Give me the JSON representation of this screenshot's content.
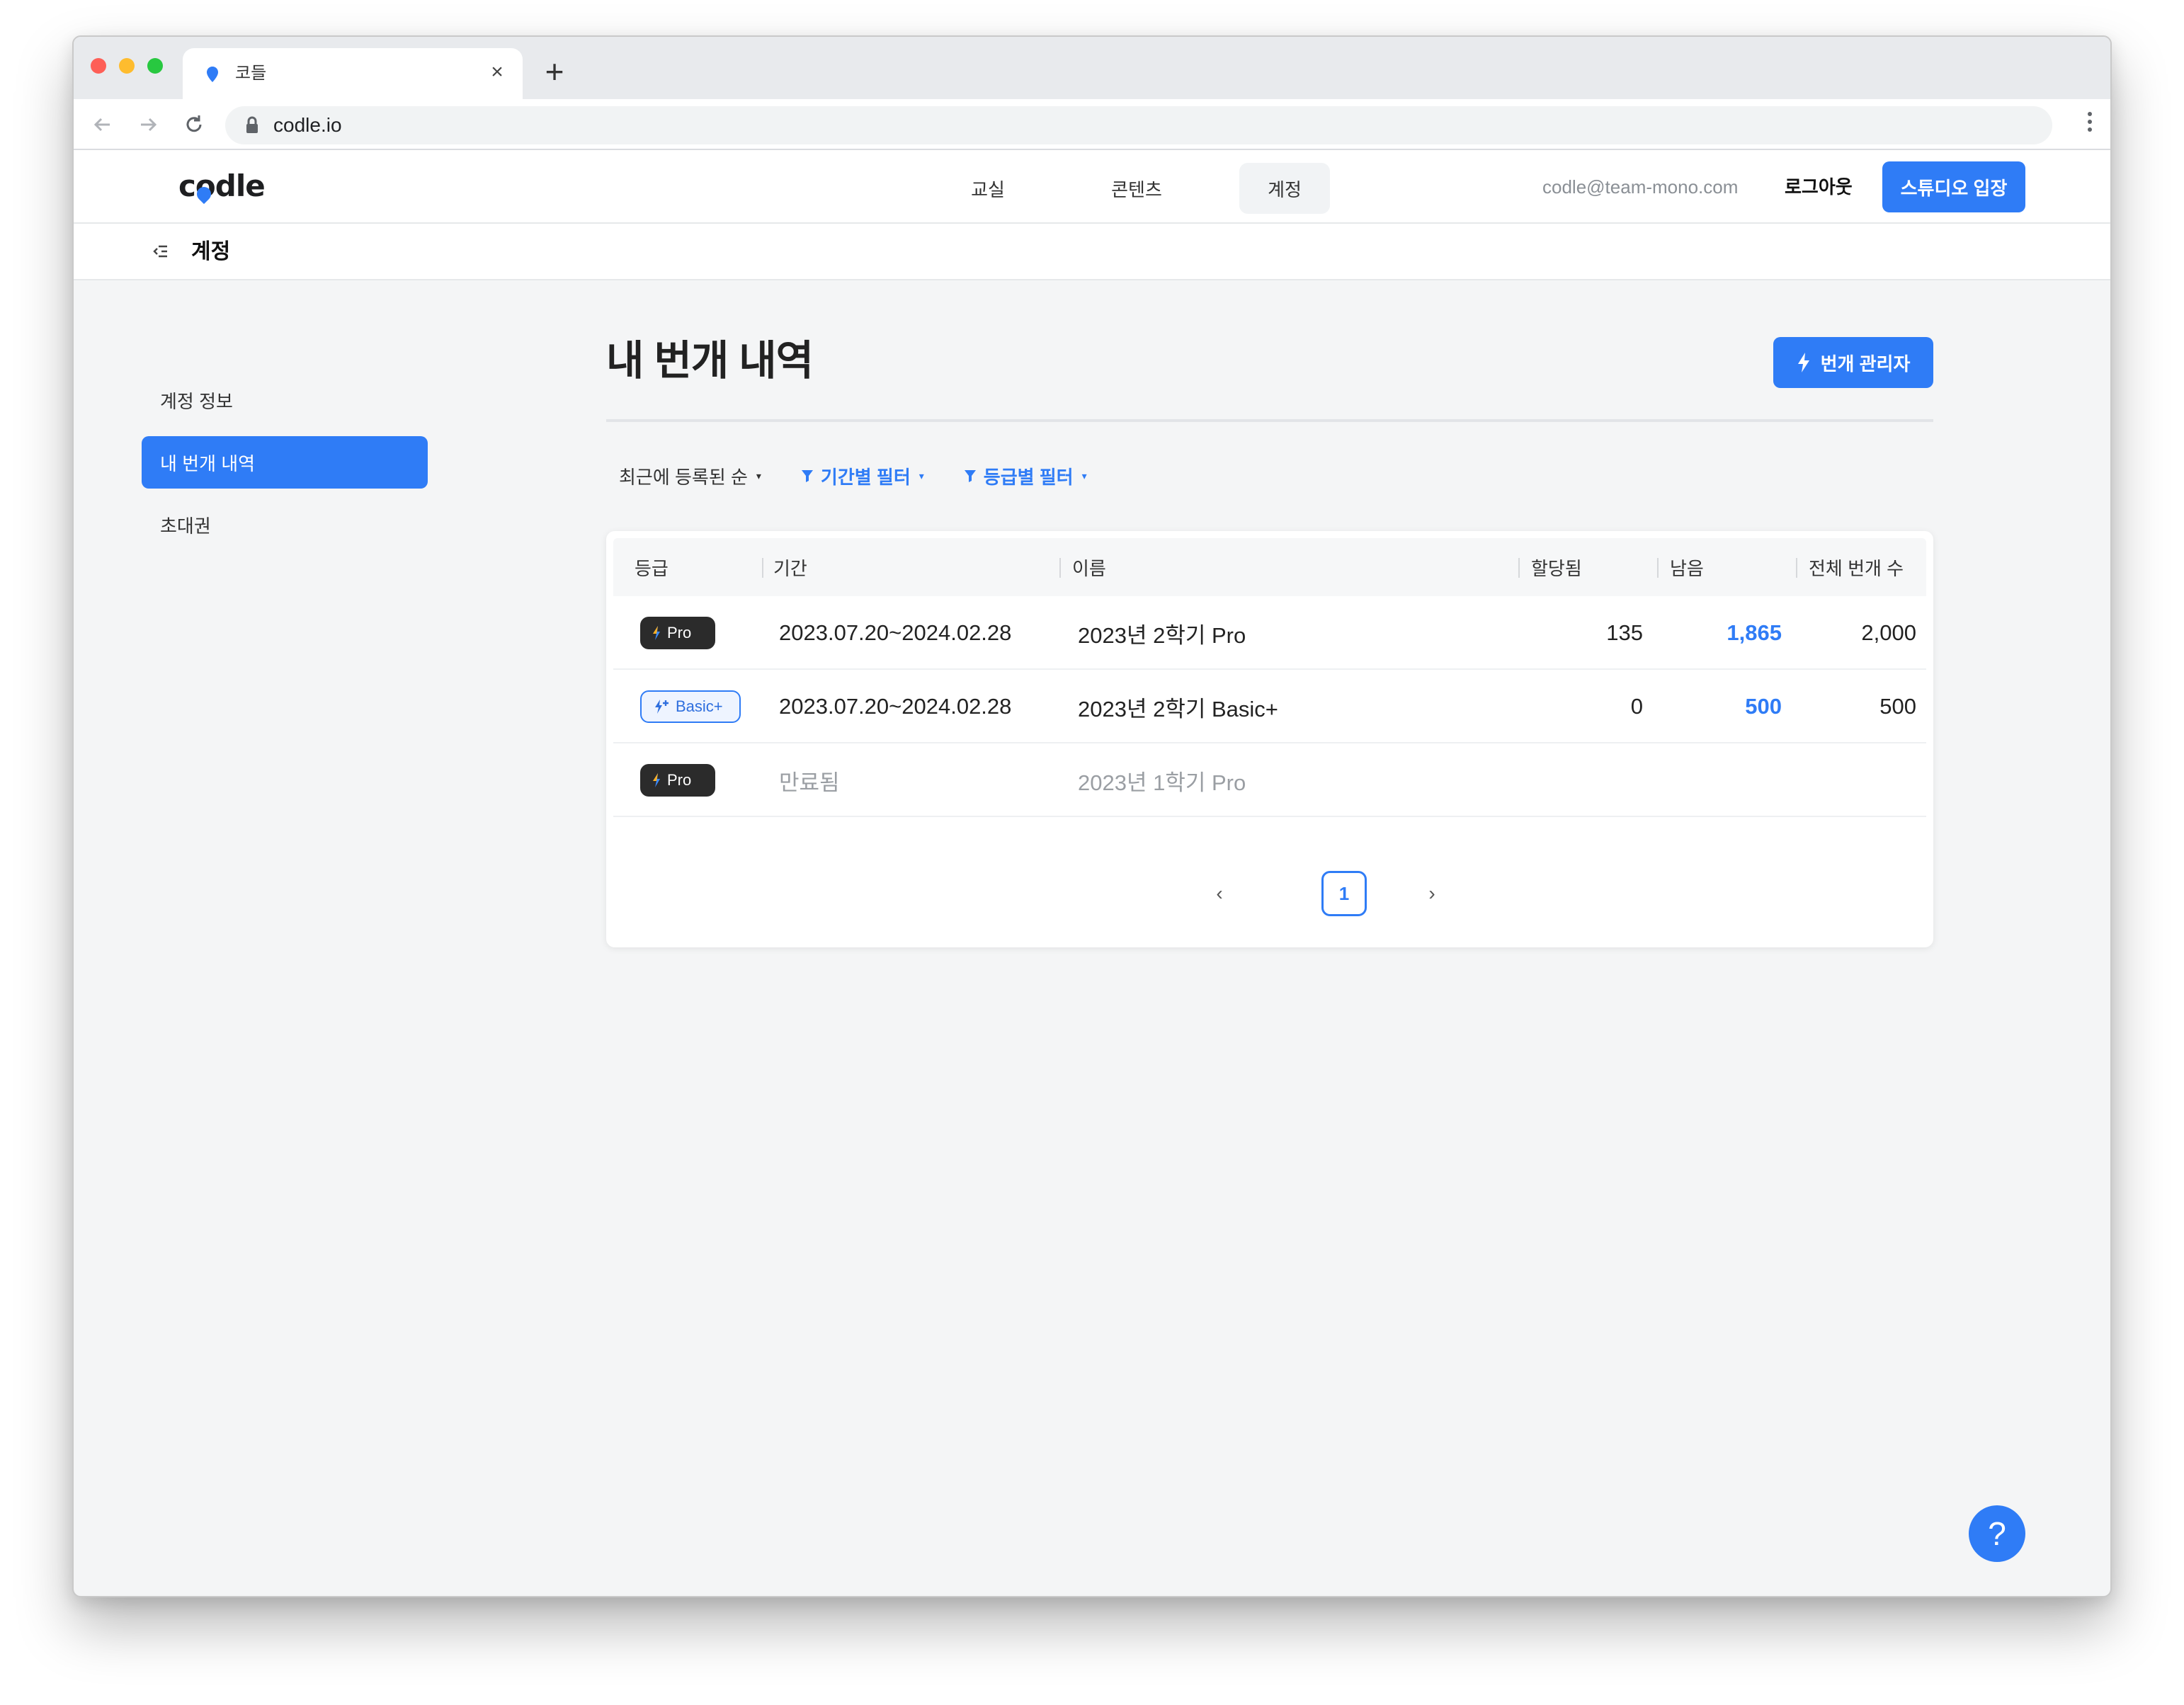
{
  "browser": {
    "tab_title": "코들",
    "url": "codle.io"
  },
  "header": {
    "logo": "codle",
    "nav": [
      "교실",
      "콘텐츠",
      "계정"
    ],
    "active_nav": "계정",
    "email": "codle@team-mono.com",
    "logout_label": "로그아웃",
    "studio_label": "스튜디오 입장"
  },
  "sub_header": {
    "title": "계정"
  },
  "sidebar": {
    "items": [
      {
        "label": "계정 정보",
        "active": false
      },
      {
        "label": "내 번개 내역",
        "active": true
      },
      {
        "label": "초대권",
        "active": false
      }
    ]
  },
  "main": {
    "title": "내 번개 내역",
    "manage_label": "번개 관리자",
    "sort_label": "최근에 등록된 순",
    "period_filter_label": "기간별 필터",
    "grade_filter_label": "등급별 필터"
  },
  "table": {
    "columns": [
      "등급",
      "기간",
      "이름",
      "할당됨",
      "남음",
      "전체 번개 수"
    ],
    "rows": [
      {
        "grade": "Pro",
        "period": "2023.07.20~2024.02.28",
        "name": "2023년 2학기 Pro",
        "allocated": "135",
        "remaining": "1,865",
        "total": "2,000",
        "expired": false
      },
      {
        "grade": "Basic+",
        "period": "2023.07.20~2024.02.28",
        "name": "2023년 2학기 Basic+",
        "allocated": "0",
        "remaining": "500",
        "total": "500",
        "expired": false
      },
      {
        "grade": "Pro",
        "period": "만료됨",
        "name": "2023년 1학기 Pro",
        "allocated": "",
        "remaining": "",
        "total": "",
        "expired": true
      }
    ]
  },
  "pagination": {
    "current_page": "1"
  },
  "help": {
    "label": "?"
  },
  "colors": {
    "accent": "#2f7cf6",
    "pro_badge": "#2b2b2b"
  }
}
